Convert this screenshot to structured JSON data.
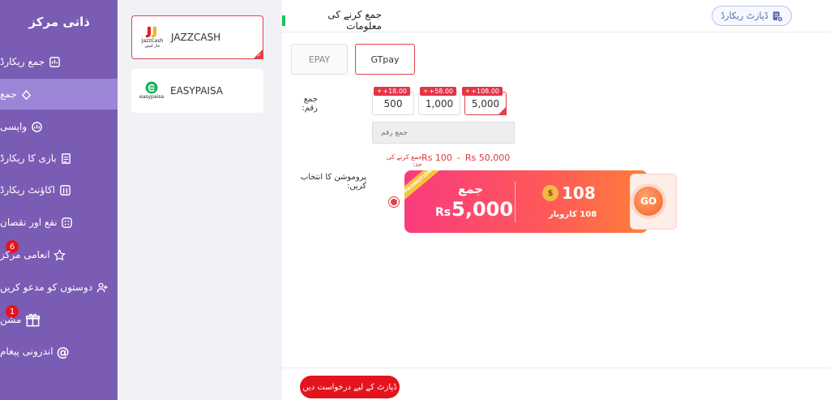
{
  "sidebar": {
    "title": "ذاتی مرکز",
    "items": [
      {
        "label": "جمع ریکارڈ",
        "icon": "deposit-record-icon"
      },
      {
        "label": "جمع",
        "icon": "deposit-icon"
      },
      {
        "label": "واپسی",
        "icon": "withdraw-icon"
      },
      {
        "label": "بازی کا ریکارڈ",
        "icon": "game-record-icon"
      },
      {
        "label": "اکاؤنٹ ریکارڈ",
        "icon": "account-record-icon"
      },
      {
        "label": "نفع اور نقصان",
        "icon": "profit-loss-icon"
      },
      {
        "label": "انعامی مرکز",
        "icon": "reward-icon",
        "badge": "6"
      },
      {
        "label": "دوستوں کو مدعو کریں",
        "icon": "invite-icon"
      },
      {
        "label": "مشن",
        "icon": "gift-icon",
        "badge": "1"
      },
      {
        "label": "اندرونی پیغام",
        "icon": "at-icon"
      }
    ]
  },
  "channels": [
    {
      "name": "JAZZCASH",
      "logo_text": "JazzCash",
      "logo_sub": "جاز کیش"
    },
    {
      "name": "EASYPAISA",
      "logo_text": "easypaisa"
    }
  ],
  "main": {
    "title": "جمع کرنے کی معلومات",
    "record_button": "ڈپازٹ ریکارڈ",
    "tabs": [
      "EPAY",
      "GTpay"
    ],
    "amount_label": "جمع رقم:",
    "amounts": [
      {
        "value": "500",
        "bonus": "+18.00"
      },
      {
        "value": "1,000",
        "bonus": "+58.00"
      },
      {
        "value": "5,000",
        "bonus": "+108.00"
      }
    ],
    "amount_placeholder": "جمع رقم",
    "limit_label": "جمع کرنے کی حد:",
    "limit_min": "Rs  100",
    "limit_sep": "-",
    "limit_max": "Rs  50,000",
    "promo_label": "پروموشن کا انتخاب کریں:",
    "promo": {
      "ribbon": "PROMOTION",
      "deposit_label": "جمع",
      "currency": "Rs",
      "deposit_amount": "5,000",
      "bonus_amount": "108",
      "bag_symbol": "$",
      "turnover": "108 کاروبار",
      "go": "GO"
    },
    "submit": "ڈپازٹ کے لیے درخواست دیں"
  },
  "colors": {
    "sidebar": "#7a5cb4",
    "sidebar_active": "#9c84d6",
    "accent_red": "#e14149",
    "green_marker": "#21c25b"
  }
}
